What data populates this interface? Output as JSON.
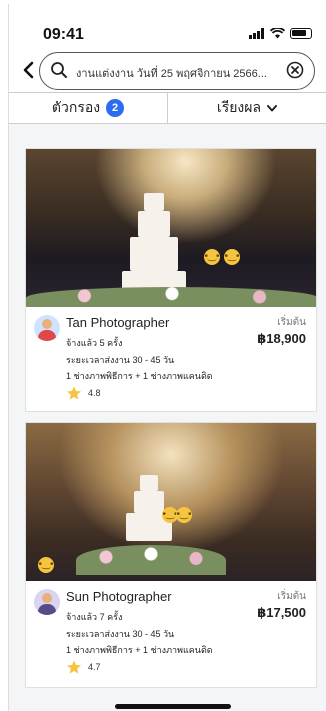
{
  "status": {
    "time": "09:41"
  },
  "search": {
    "query": "งานแต่งงาน วันที่ 25 พฤศจิกายน 2566..."
  },
  "toolbar": {
    "filter_label": "ตัวกรอง",
    "filter_count": "2",
    "sort_label": "เรียงผล"
  },
  "results": [
    {
      "name": "Tan Photographer",
      "hired": "จ้างแล้ว 5 ครั้ง",
      "delivery": "ระยะเวลาส่งงาน 30 - 45 วัน",
      "team": "1 ช่างภาพพิธีการ + 1 ช่างภาพแคนดิด",
      "rating": "4.8",
      "price_label": "เริ่มต้น",
      "price": "฿18,900"
    },
    {
      "name": "Sun Photographer",
      "hired": "จ้างแล้ว 7 ครั้ง",
      "delivery": "ระยะเวลาส่งงาน 30 - 45 วัน",
      "team": "1 ช่างภาพพิธีการ + 1 ช่างภาพแคนดิด",
      "rating": "4.7",
      "price_label": "เริ่มต้น",
      "price": "฿17,500"
    }
  ],
  "colors": {
    "accent": "#2d6cf0",
    "star": "#f5c542"
  }
}
